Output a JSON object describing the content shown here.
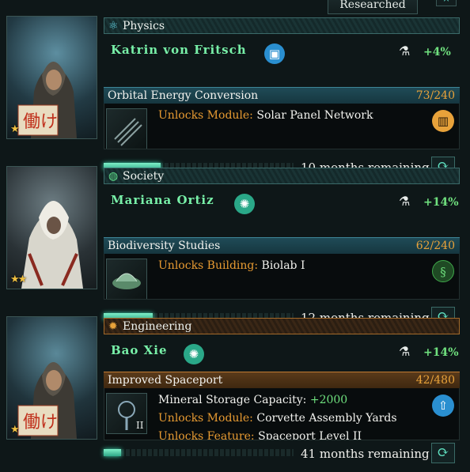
{
  "header": {
    "researched_tab": "Researched",
    "close_glyph": "×"
  },
  "cards": [
    {
      "category": "Physics",
      "category_icon": "atom-icon",
      "scientist": "Katrin von Fritsch",
      "trait_icon": "computer-icon",
      "trait_color": "#2a8fd0",
      "bonus": "+4%",
      "stars": "★",
      "project": "Orbital Energy Conversion",
      "progress_text": "73/240",
      "progress_fraction": 0.3,
      "lines": [
        {
          "label": "Unlocks Module:",
          "value": "Solar Panel Network"
        }
      ],
      "effect_icon": "factory-icon",
      "effect_color": "#e8a23a",
      "remaining": "10 months remaining"
    },
    {
      "category": "Society",
      "category_icon": "globe-icon",
      "scientist": "Mariana Ortiz",
      "trait_icon": "lightbulb-icon",
      "trait_color": "#2aa888",
      "bonus": "+14%",
      "stars": "★★",
      "project": "Biodiversity Studies",
      "progress_text": "62/240",
      "progress_fraction": 0.26,
      "lines": [
        {
          "label": "Unlocks Building:",
          "value": "Biolab I"
        }
      ],
      "effect_icon": "dna-icon",
      "effect_color": "#3fa84a",
      "remaining": "12 months remaining"
    },
    {
      "category": "Engineering",
      "category_icon": "gear-icon",
      "scientist": "Bao Xie",
      "trait_icon": "lightbulb-icon",
      "trait_color": "#2aa888",
      "bonus": "+14%",
      "stars": "★",
      "project": "Improved Spaceport",
      "progress_text": "42/480",
      "progress_fraction": 0.09,
      "lines": [
        {
          "label": "Mineral Storage Capacity:",
          "value": "+2000"
        },
        {
          "label": "Unlocks Module:",
          "value": "Corvette Assembly Yards"
        },
        {
          "label": "Unlocks Feature:",
          "value": "Spaceport Level II"
        }
      ],
      "thumb_badge": "II",
      "effect_icon": "rocket-icon",
      "effect_color": "#2a8fd0",
      "remaining": "41 months remaining"
    }
  ]
}
